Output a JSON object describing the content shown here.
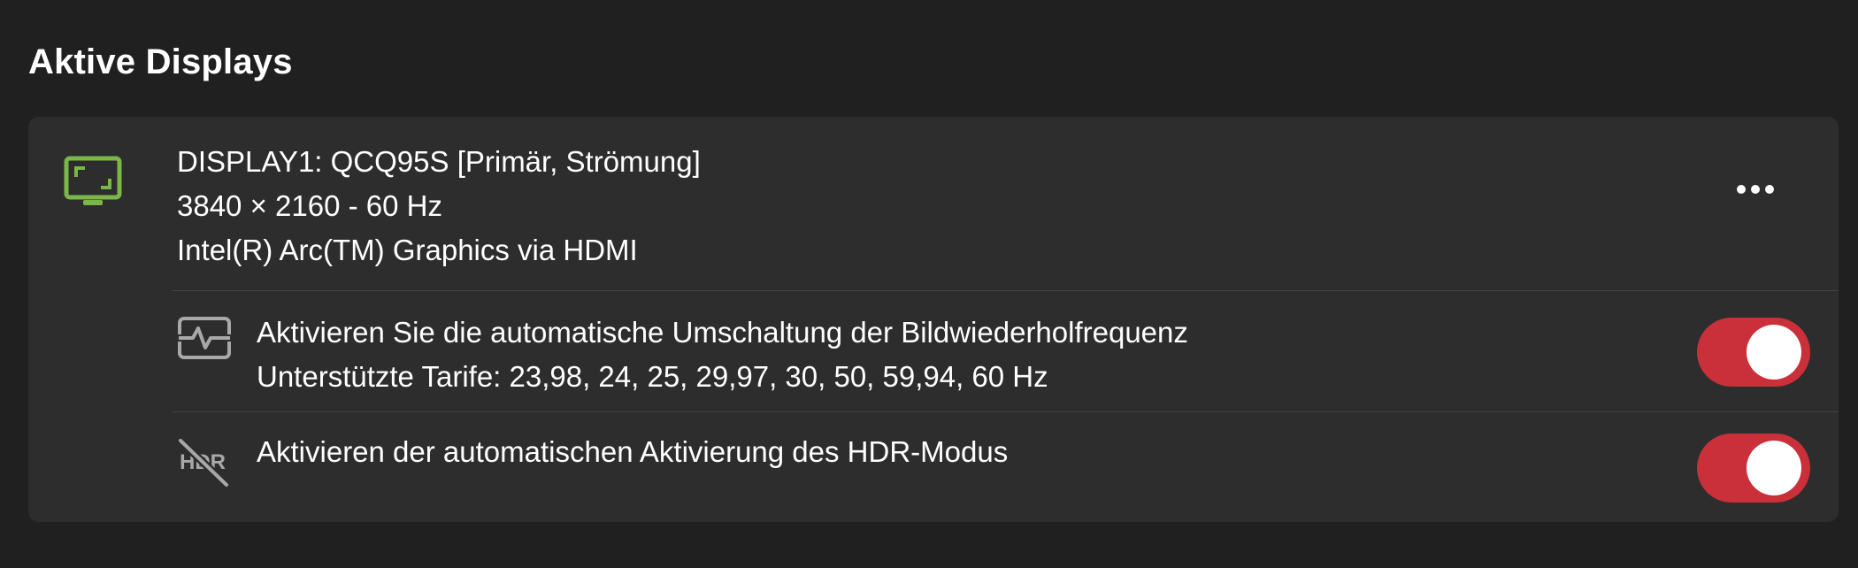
{
  "section": {
    "title": "Aktive Displays"
  },
  "display": {
    "name": "DISPLAY1: QCQ95S [Primär, Strömung]",
    "resolution": "3840 × 2160 - 60 Hz",
    "adapter": "Intel(R) Arc(TM) Graphics via HDMI",
    "icon": "monitor-icon",
    "icon_color": "#7ab648",
    "more_icon": "more-horizontal-icon"
  },
  "settings": [
    {
      "label": "Aktivieren Sie die automatische Umschaltung der Bildwiederholfrequenz",
      "sublabel": "Unterstützte Tarife: 23,98, 24, 25, 29,97, 30, 50, 59,94, 60 Hz",
      "icon": "refresh-rate-icon",
      "enabled": true
    },
    {
      "label": "Aktivieren der automatischen Aktivierung des HDR-Modus",
      "icon": "hdr-off-icon",
      "icon_text": "HDR",
      "enabled": true
    }
  ],
  "colors": {
    "background": "#202020",
    "card": "#2d2d2d",
    "toggle_on": "#c9303a",
    "icon_gray": "#a8a8a8"
  }
}
